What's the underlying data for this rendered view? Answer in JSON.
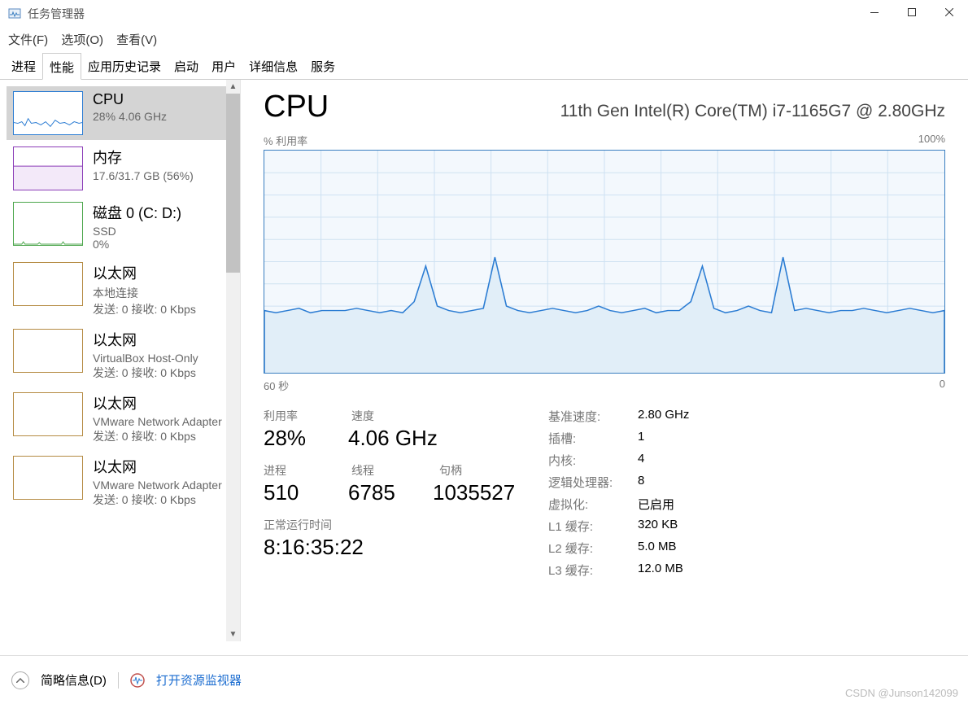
{
  "window": {
    "title": "任务管理器"
  },
  "menubar": {
    "file": "文件(F)",
    "options": "选项(O)",
    "view": "查看(V)"
  },
  "tabs": {
    "processes": "进程",
    "performance": "性能",
    "history": "应用历史记录",
    "startup": "启动",
    "users": "用户",
    "details": "详细信息",
    "services": "服务"
  },
  "sidebar": {
    "cpu": {
      "title": "CPU",
      "sub": "28%  4.06 GHz",
      "color": "#2b7cd3"
    },
    "memory": {
      "title": "内存",
      "sub": "17.6/31.7 GB (56%)",
      "color": "#8b3db8"
    },
    "disk": {
      "title": "磁盘 0 (C: D:)",
      "sub1": "SSD",
      "sub2": "0%",
      "color": "#4ca64c"
    },
    "eth1": {
      "title": "以太网",
      "sub1": "本地连接",
      "sub2": "发送: 0  接收: 0 Kbps",
      "color": "#b58b43"
    },
    "eth2": {
      "title": "以太网",
      "sub1": "VirtualBox Host-Only",
      "sub2": "发送: 0  接收: 0 Kbps",
      "color": "#b58b43"
    },
    "eth3": {
      "title": "以太网",
      "sub1": "VMware Network Adapter",
      "sub2": "发送: 0  接收: 0 Kbps",
      "color": "#b58b43"
    },
    "eth4": {
      "title": "以太网",
      "sub1": "VMware Network Adapter",
      "sub2": "发送: 0  接收: 0 Kbps",
      "color": "#b58b43"
    }
  },
  "main": {
    "title": "CPU",
    "cpu_name": "11th Gen Intel(R) Core(TM) i7-1165G7 @ 2.80GHz",
    "util_label": "% 利用率",
    "util_max": "100%",
    "time_label": "60 秒",
    "time_right": "0",
    "stats": {
      "util_label": "利用率",
      "util_value": "28%",
      "speed_label": "速度",
      "speed_value": "4.06 GHz",
      "proc_label": "进程",
      "proc_value": "510",
      "thread_label": "线程",
      "thread_value": "6785",
      "handle_label": "句柄",
      "handle_value": "1035527",
      "uptime_label": "正常运行时间",
      "uptime_value": "8:16:35:22"
    },
    "specs": {
      "base_label": "基准速度:",
      "base_value": "2.80 GHz",
      "sockets_label": "插槽:",
      "sockets_value": "1",
      "cores_label": "内核:",
      "cores_value": "4",
      "lproc_label": "逻辑处理器:",
      "lproc_value": "8",
      "virt_label": "虚拟化:",
      "virt_value": "已启用",
      "l1_label": "L1 缓存:",
      "l1_value": "320 KB",
      "l2_label": "L2 缓存:",
      "l2_value": "5.0 MB",
      "l3_label": "L3 缓存:",
      "l3_value": "12.0 MB"
    }
  },
  "statusbar": {
    "fewer": "简略信息(D)",
    "resmon": "打开资源监视器"
  },
  "watermark": "CSDN @Junson142099",
  "chart_data": {
    "type": "line",
    "title": "% 利用率",
    "xlabel": "60 秒",
    "ylabel": "",
    "ylim": [
      0,
      100
    ],
    "xlim": [
      60,
      0
    ],
    "series": [
      {
        "name": "CPU",
        "values": [
          28,
          27,
          28,
          29,
          27,
          28,
          28,
          28,
          29,
          28,
          27,
          28,
          27,
          32,
          48,
          30,
          28,
          27,
          28,
          29,
          52,
          30,
          28,
          27,
          28,
          29,
          28,
          27,
          28,
          30,
          28,
          27,
          28,
          29,
          27,
          28,
          28,
          32,
          48,
          29,
          27,
          28,
          30,
          28,
          27,
          52,
          28,
          29,
          28,
          27,
          28,
          28,
          29,
          28,
          27,
          28,
          29,
          28,
          27,
          28
        ]
      }
    ]
  }
}
